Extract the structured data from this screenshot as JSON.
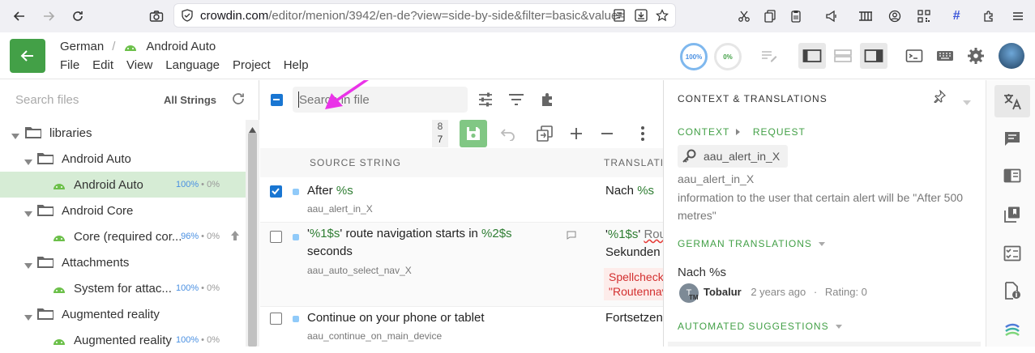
{
  "browser": {
    "url_domain": "crowdin.com",
    "url_path": "/editor/menion/3942/en-de?view=side-by-side&filter=basic&value="
  },
  "app": {
    "crumb_project": "German",
    "crumb_separator": "/",
    "crumb_file": "Android Auto",
    "menu": [
      "File",
      "Edit",
      "View",
      "Language",
      "Project",
      "Help"
    ],
    "progress_translated": "100%",
    "progress_approved": "0%"
  },
  "left": {
    "search_placeholder": "Search files",
    "filter_label": "All Strings",
    "tree": [
      {
        "label": "libraries",
        "type": "folder",
        "level": 0
      },
      {
        "label": "Android Auto",
        "type": "folder",
        "level": 1
      },
      {
        "label": "Android Auto",
        "type": "file",
        "level": 2,
        "pct": "100%",
        "approved": "0%",
        "selected": true
      },
      {
        "label": "Android Core",
        "type": "folder",
        "level": 1
      },
      {
        "label": "Core (required cor...",
        "type": "file",
        "level": 2,
        "pct": "96%",
        "approved": "0%"
      },
      {
        "label": "Attachments",
        "type": "folder",
        "level": 1
      },
      {
        "label": "System for attac...",
        "type": "file",
        "level": 2,
        "pct": "100%",
        "approved": "0%"
      },
      {
        "label": "Augmented reality",
        "type": "folder",
        "level": 1
      },
      {
        "label": "Augmented reality",
        "type": "file",
        "level": 2,
        "pct": "100%",
        "approved": "0%"
      }
    ],
    "pct_separator": " • "
  },
  "mid": {
    "search_placeholder": "Search in file",
    "count_top": "8",
    "count_bottom": "7",
    "col_source": "SOURCE STRING",
    "col_translation": "TRANSLATIO",
    "rows": [
      {
        "src_a": "After ",
        "src_ph": "%s",
        "key": "aau_alert_in_X",
        "tr_a": "Nach ",
        "tr_ph": "%s"
      },
      {
        "src_q1": "'",
        "src_ph1": "%1$s",
        "src_q2": "' route navigation starts in ",
        "src_ph2": "%2$s",
        "src_line2": "seconds",
        "key": "aau_auto_select_nav_X",
        "tr_q1": "'",
        "tr_ph1": "%1$s",
        "tr_q2": "' ",
        "tr_rest": "Rou",
        "tr_line2": "Sekunden",
        "warn1": "Spellcheck",
        "warn2": "\"Routennav"
      },
      {
        "src": "Continue on your phone or tablet",
        "key": "aau_continue_on_main_device",
        "tr": "Fortsetzen"
      }
    ]
  },
  "right": {
    "title": "CONTEXT & TRANSLATIONS",
    "context_label": "CONTEXT",
    "request_label": "REQUEST",
    "key_chip": "aau_alert_in_X",
    "key_line": "aau_alert_in_X",
    "context_desc": "information to the user that certain alert will be \"After 500 metres\"",
    "german_label": "GERMAN TRANSLATIONS",
    "translation_text": "Nach %s",
    "author": "Tobalur",
    "author_time": "2 years ago",
    "rating": "Rating: 0",
    "avatar_letters": "T",
    "avatar_sub": "TM",
    "automated_label": "AUTOMATED SUGGESTIONS"
  },
  "colors": {
    "accent": "#43a047",
    "placeholder": "#2e7d32",
    "selected_row": "#d6ecd5",
    "annotation_arrow": "#ea33e8"
  }
}
